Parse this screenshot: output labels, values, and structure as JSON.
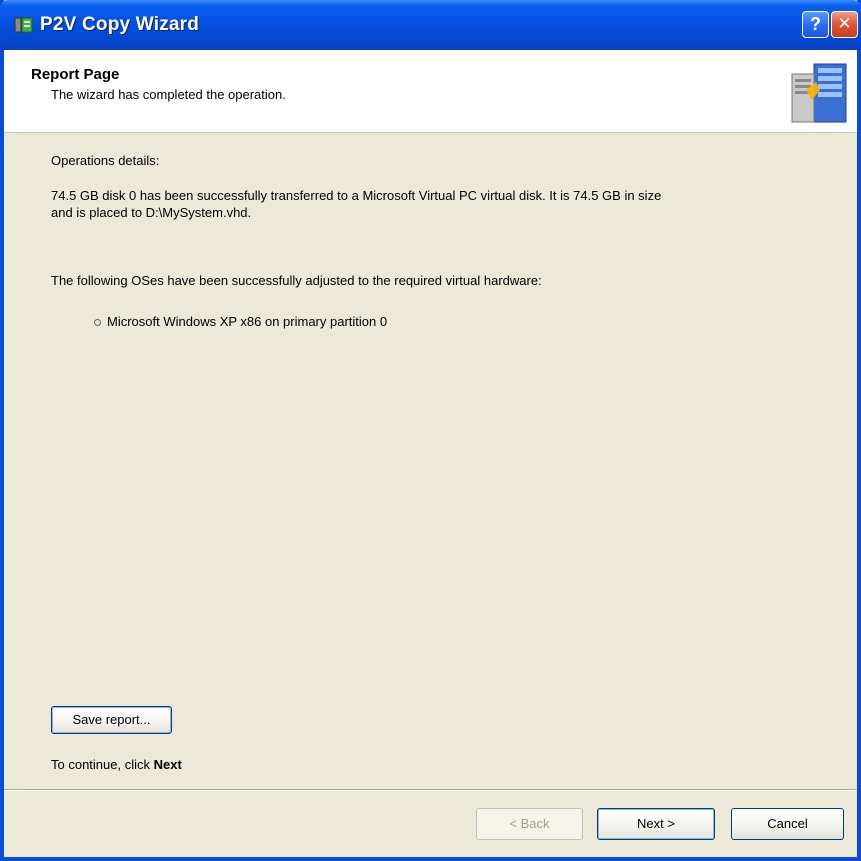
{
  "window": {
    "title": "P2V Copy Wizard"
  },
  "title_buttons": {
    "help": "?",
    "close": "✕"
  },
  "header": {
    "title": "Report Page",
    "subtitle": "The wizard has completed the operation."
  },
  "content": {
    "ops_label": "Operations details:",
    "detail_line1": "74.5 GB disk 0 has been successfully transferred to a Microsoft Virtual PC virtual disk. It is 74.5 GB in size",
    "detail_line2": "and is placed to D:\\MySystem.vhd.",
    "adjusted_label": "The following OSes have been successfully adjusted to the required virtual hardware:",
    "os_list": [
      "Microsoft Windows XP x86 on primary partition 0"
    ],
    "save_button": "Save report...",
    "continue_prefix": "To continue, click ",
    "continue_bold": "Next"
  },
  "footer": {
    "back": "< Back",
    "next": "Next >",
    "cancel": "Cancel"
  },
  "colors": {
    "titlebar": "#0550e0",
    "dialog_bg": "#ece9d8",
    "header_bg": "#ffffff",
    "close_button": "#e0593a"
  },
  "icons": {
    "app": "p2v-app-icon",
    "header": "server-computer-icon"
  }
}
